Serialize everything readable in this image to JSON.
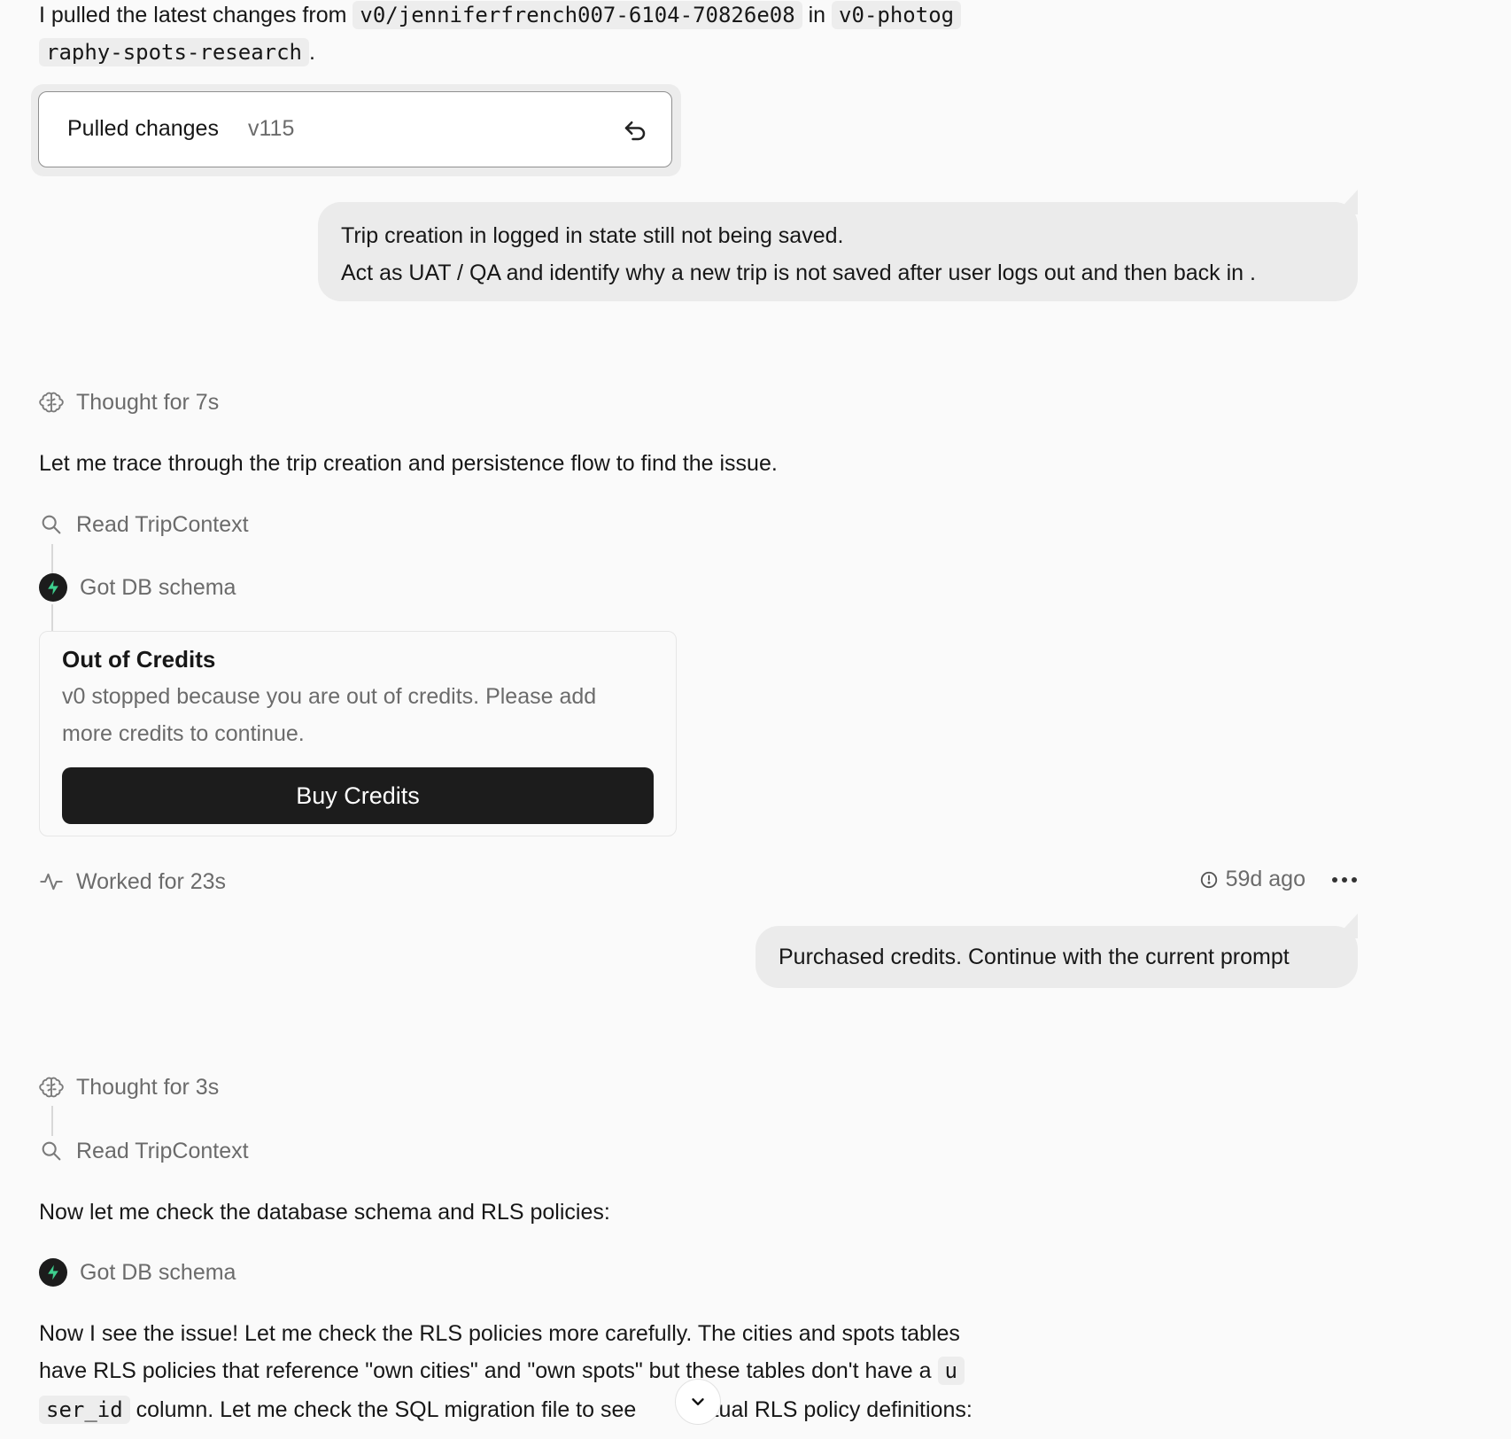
{
  "intro": {
    "prefix": "I pulled the latest changes from",
    "branch": "v0/jenniferfrench007-6104-70826e08",
    "middle": "in",
    "repo_line1": "v0-photog",
    "repo_line2": "raphy-spots-research",
    "suffix": "."
  },
  "pulled_card": {
    "label": "Pulled changes",
    "version": "v115",
    "action_icon": "revert-icon"
  },
  "user_message_1": {
    "line1": "Trip creation in logged in state still not being saved.",
    "line2": "Act as UAT / QA and identify why a new trip is not saved after user logs out and then back in ."
  },
  "turn1": {
    "thought": "Thought for 7s",
    "message": "Let me trace through the trip creation and persistence flow to find the issue.",
    "step_read": "Read TripContext",
    "step_schema": "Got DB schema",
    "credits_card": {
      "title": "Out of Credits",
      "description": "v0 stopped because you are out of credits. Please add more credits to continue.",
      "button": "Buy Credits"
    },
    "worked": "Worked for 23s",
    "timestamp": "59d ago"
  },
  "user_message_2": {
    "text": "Purchased credits. Continue with the current prompt"
  },
  "turn2": {
    "thought": "Thought for 3s",
    "step_read": "Read TripContext",
    "message1": "Now let me check the database schema and RLS policies:",
    "step_schema": "Got DB schema",
    "paragraph": {
      "line1": "Now I see the issue! Let me check the RLS policies more carefully. The cities and spots tables",
      "line2_text": "have RLS policies that reference \"own cities\" and \"own spots\" but these tables don't have a",
      "code_part1": "u",
      "code_part2": "ser_id",
      "line3_a": "column. Let me check the SQL migration file to see",
      "line3_b": "actual RLS policy definitions:"
    }
  },
  "colors": {
    "background": "#fafafa",
    "bubble": "#ebebeb",
    "button": "#1c1c1c",
    "supabase_green": "#3ecf8e",
    "muted_text": "#6b6b6b"
  }
}
